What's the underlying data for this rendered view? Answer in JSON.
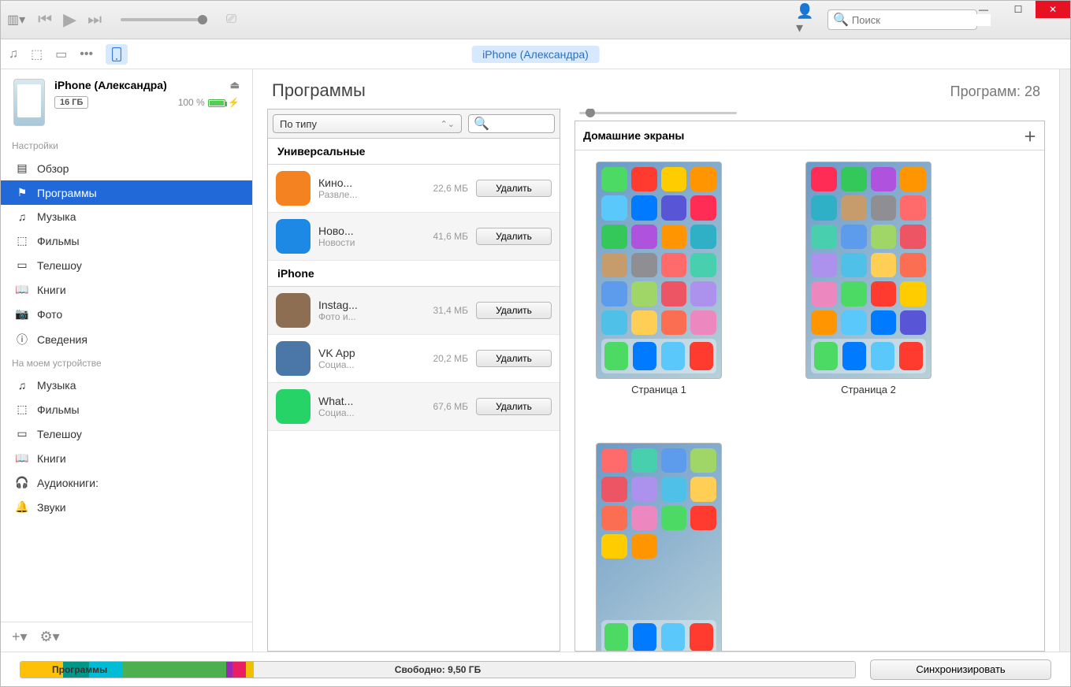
{
  "search_placeholder": "Поиск",
  "device_pill": "iPhone (Александра)",
  "device": {
    "name": "iPhone (Александра)",
    "storage_badge": "16 ГБ",
    "battery_pct": "100 %"
  },
  "sidebar": {
    "section_settings": "Настройки",
    "section_ondevice": "На моем устройстве",
    "settings": [
      {
        "label": "Обзор"
      },
      {
        "label": "Программы"
      },
      {
        "label": "Музыка"
      },
      {
        "label": "Фильмы"
      },
      {
        "label": "Телешоу"
      },
      {
        "label": "Книги"
      },
      {
        "label": "Фото"
      },
      {
        "label": "Сведения"
      }
    ],
    "ondevice": [
      {
        "label": "Музыка"
      },
      {
        "label": "Фильмы"
      },
      {
        "label": "Телешоу"
      },
      {
        "label": "Книги"
      },
      {
        "label": "Аудиокниги:"
      },
      {
        "label": "Звуки"
      }
    ]
  },
  "content": {
    "title": "Программы",
    "count_label": "Программ: 28",
    "sort_label": "По типу",
    "groups": {
      "universal": "Универсальные",
      "iphone": "iPhone"
    },
    "remove_label": "Удалить",
    "apps_universal": [
      {
        "name": "Кино...",
        "cat": "Развле...",
        "size": "22,6 МБ",
        "bg": "#f58220"
      },
      {
        "name": "Ново...",
        "cat": "Новости",
        "size": "41,6 МБ",
        "bg": "#1e88e5"
      }
    ],
    "apps_iphone": [
      {
        "name": "Instag...",
        "cat": "Фото и...",
        "size": "31,4 МБ",
        "bg": "#8e6e53"
      },
      {
        "name": "VK App",
        "cat": "Социа...",
        "size": "20,2 МБ",
        "bg": "#4a76a8"
      },
      {
        "name": "What...",
        "cat": "Социа...",
        "size": "67,6 МБ",
        "bg": "#25d366"
      }
    ]
  },
  "screens": {
    "header": "Домашние экраны",
    "pages": [
      {
        "label": "Страница 1"
      },
      {
        "label": "Страница 2"
      },
      {
        "label": ""
      }
    ]
  },
  "storage": {
    "free_label": "Свободно: 9,50 ГБ",
    "apps_label": "Программы",
    "sync_label": "Синхронизировать",
    "segments": [
      {
        "color": "#f0c000",
        "w": 1
      },
      {
        "color": "#e91e63",
        "w": 1.5
      },
      {
        "color": "#9c27b0",
        "w": 0.8
      },
      {
        "color": "#4caf50",
        "w": 12
      },
      {
        "color": "#00bcd4",
        "w": 4
      },
      {
        "color": "#009688",
        "w": 3
      },
      {
        "color": "#ffc107",
        "w": 5
      }
    ]
  },
  "home_icon_colors": [
    "#4cd964",
    "#ff3b30",
    "#ffcc00",
    "#ff9500",
    "#5ac8fa",
    "#007aff",
    "#5856d6",
    "#ff2d55",
    "#34c759",
    "#af52de",
    "#ff9500",
    "#30b0c7",
    "#c69c6d",
    "#8e8e93",
    "#ff6b6b",
    "#48cfad",
    "#5d9cec",
    "#a0d568",
    "#ed5565",
    "#ac92ec",
    "#4fc1e9",
    "#ffce54",
    "#fc6e51",
    "#ec87c0"
  ],
  "dock_colors": [
    "#4cd964",
    "#007aff",
    "#5ac8fa",
    "#ff3b30"
  ]
}
